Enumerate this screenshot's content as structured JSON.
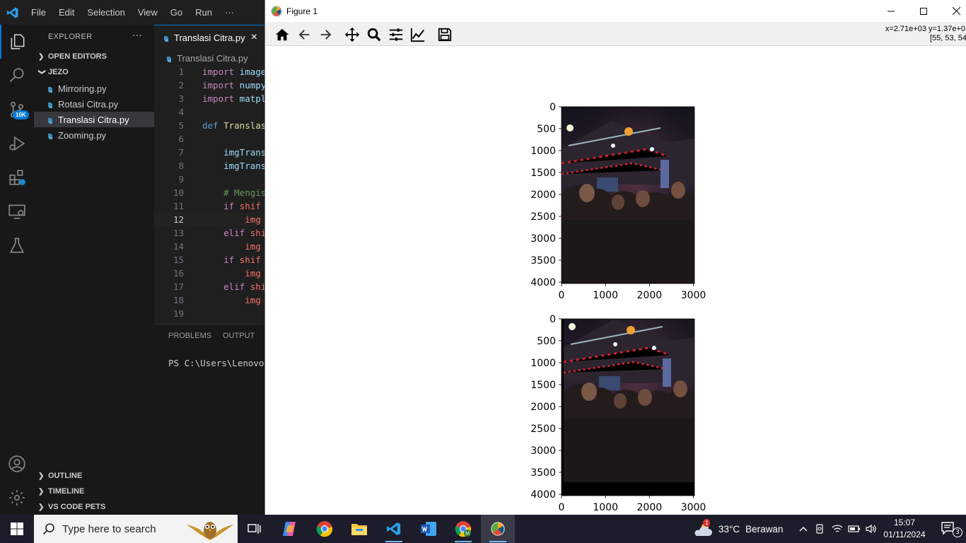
{
  "vscode": {
    "menu": [
      "File",
      "Edit",
      "Selection",
      "View",
      "Go",
      "Run",
      "···"
    ],
    "badge": "10K",
    "sidebar": {
      "title": "EXPLORER",
      "more": "···",
      "open_editors": "OPEN EDITORS",
      "folder": "JEZO",
      "files": [
        "Mirroring.py",
        "Rotasi Citra.py",
        "Translasi Citra.py",
        "Zooming.py"
      ],
      "outline": "OUTLINE",
      "timeline": "TIMELINE",
      "pets": "VS CODE PETS"
    },
    "tab": {
      "label": "Translasi Citra.py",
      "close": "×"
    },
    "breadcrumb": "Translasi Citra.py",
    "code_lines": [
      {
        "n": "1",
        "a": "import",
        "b": " image"
      },
      {
        "n": "2",
        "a": "import",
        "b": " numpy"
      },
      {
        "n": "3",
        "a": "import",
        "b": " matpl"
      },
      {
        "n": "4",
        "a": "",
        "b": ""
      },
      {
        "n": "5",
        "a": "def",
        "b": " Translas"
      },
      {
        "n": "6",
        "a": "",
        "b": ""
      },
      {
        "n": "7",
        "a": "",
        "b": "    imgTrans"
      },
      {
        "n": "8",
        "a": "",
        "b": "    imgTrans"
      },
      {
        "n": "9",
        "a": "",
        "b": ""
      },
      {
        "n": "10",
        "a": "",
        "b": "    # Mengis"
      },
      {
        "n": "11",
        "a": "    if",
        "b": " shif"
      },
      {
        "n": "12",
        "a": "",
        "b": "        img"
      },
      {
        "n": "13",
        "a": "    elif",
        "b": " shi"
      },
      {
        "n": "14",
        "a": "",
        "b": "        img"
      },
      {
        "n": "15",
        "a": "    if",
        "b": " shif"
      },
      {
        "n": "16",
        "a": "",
        "b": "        img"
      },
      {
        "n": "17",
        "a": "    elif",
        "b": " shi"
      },
      {
        "n": "18",
        "a": "",
        "b": "        img"
      },
      {
        "n": "19",
        "a": "",
        "b": ""
      }
    ],
    "panel": {
      "problems": "PROBLEMS",
      "output": "OUTPUT",
      "terminal": "PS C:\\Users\\Lenovo\\D"
    }
  },
  "figure": {
    "title": "Figure 1",
    "coord_readout": "x=2.71e+03 y=1.37e+0",
    "pixel_readout": "[55, 53, 54",
    "toolbar": [
      "home-icon",
      "back-icon",
      "forward-icon",
      "pan-icon",
      "zoom-icon",
      "subplots-icon",
      "edit-curves-icon",
      "save-icon"
    ],
    "plots": [
      {
        "name": "original",
        "yticks": [
          "0",
          "500",
          "1000",
          "1500",
          "2000",
          "2500",
          "3000",
          "3500",
          "4000"
        ],
        "xticks": [
          "0",
          "1000",
          "2000",
          "3000"
        ]
      },
      {
        "name": "translated",
        "yticks": [
          "0",
          "500",
          "1000",
          "1500",
          "2000",
          "2500",
          "3000",
          "3500",
          "4000"
        ],
        "xticks": [
          "0",
          "1000",
          "2000",
          "3000"
        ]
      }
    ]
  },
  "taskbar": {
    "search_placeholder": "Type here to search",
    "weather_temp": "33°C",
    "weather_desc": "Berawan",
    "weather_badge": "1",
    "time": "15:07",
    "date": "01/11/2024",
    "notification_count": "3"
  }
}
